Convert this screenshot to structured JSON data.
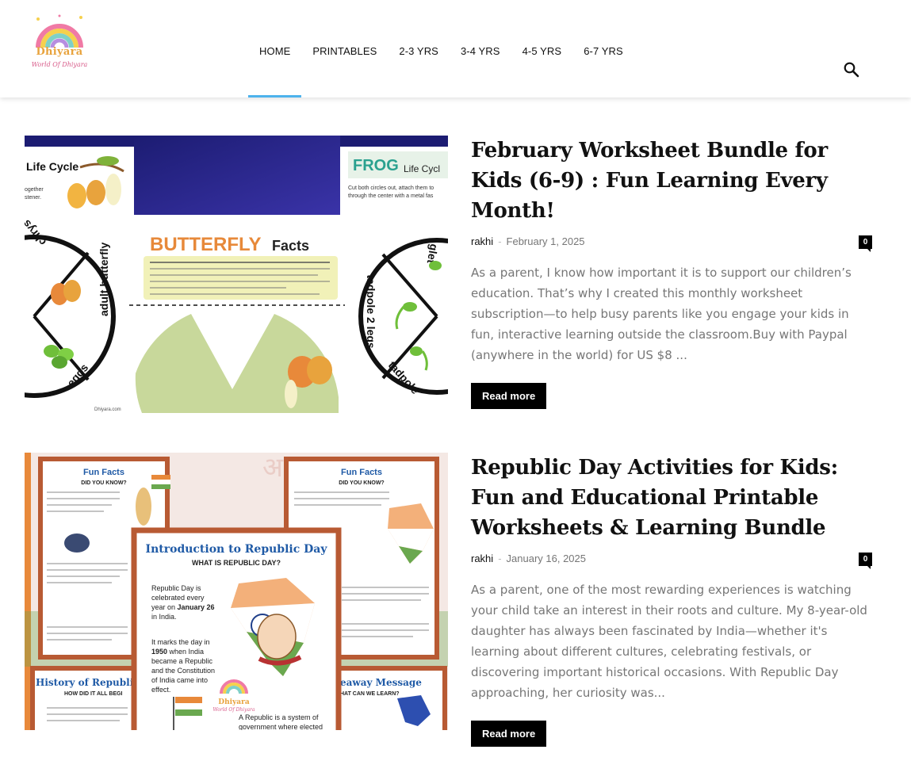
{
  "site": {
    "logo_name": "Dhiyara",
    "logo_tagline": "World Of Dhiyara"
  },
  "nav": {
    "items": [
      {
        "label": "HOME",
        "active": true
      },
      {
        "label": "PRINTABLES"
      },
      {
        "label": "2-3 YRS"
      },
      {
        "label": "3-4 YRS"
      },
      {
        "label": "4-5 YRS"
      },
      {
        "label": "6-7 YRS"
      }
    ],
    "search_icon": "search-icon"
  },
  "posts": [
    {
      "title": "February Worksheet Bundle for Kids (6-9) : Fun Learning Every Month!",
      "author": "rakhi",
      "separator": "-",
      "date": "February 1, 2025",
      "comments": "0",
      "excerpt": "As a parent, I know how important it is to support our children’s education. That’s why I created this monthly worksheet subscription—to help busy parents like you engage your kids in fun, interactive learning outside the classroom.Buy with Paypal (anywhere in the world) for US $8 ...",
      "read_more": "Read more",
      "image": {
        "left_title": "Life Cycle",
        "left_sub": "ogether\nstener.",
        "frog_title": "FROG",
        "frog_sub": "Life Cycl",
        "frog_note": "Cut both circles out, attach them to\nthrough the center with a metal fas",
        "facts_title": "BUTTERFLY",
        "facts_title_2": "Facts",
        "wheel_left_1": "adult butterfly",
        "wheel_left_2": "eggs",
        "wheel_left_3": "chrys",
        "wheel_right_1": "tadpole 2 legs",
        "wheel_right_2": "tadpole",
        "wheel_right_3": "glet",
        "footer": "Dhiyara.com"
      }
    },
    {
      "title": "Republic Day Activities for Kids: Fun and Educational Printable Worksheets & Learning Bundle",
      "author": "rakhi",
      "separator": "-",
      "date": "January 16, 2025",
      "comments": "0",
      "excerpt": "As a parent, one of the most rewarding experiences is watching your child take an interest in their roots and culture. My 8-year-old daughter has always been fascinated by India—whether it's learning about different cultures, celebrating festivals, or discovering important historical occasions. With Republic Day approaching, her curiosity was...",
      "read_more": "Read more",
      "image": {
        "card_left_title": "Fun Facts",
        "card_left_sub": "DID YOU KNOW?",
        "card_right_title": "Fun Facts",
        "card_right_sub": "DID YOU KNOW?",
        "center_title": "Introduction to Republic Day",
        "center_sub": "WHAT IS REPUBLIC DAY?",
        "center_p1": "Republic Day is celebrated every year on January 26 in India.",
        "center_p2": "It marks the day in 1950 when India became a Republic and the Constitution of India came into effect.",
        "center_p3": "A Republic is a system of government where elected",
        "bottom_left_title": "History of Republi",
        "bottom_left_sub": "HOW DID IT ALL BEGI",
        "bottom_right_title": "eaway Message",
        "bottom_right_sub": "HAT CAN WE LEARN?",
        "logo_name": "Dhiyara",
        "logo_tagline": "World Of Dhiyara"
      }
    }
  ],
  "colors": {
    "nav_active_underline": "#4db2ec",
    "excerpt_text": "#767676",
    "button_bg": "#000000"
  }
}
